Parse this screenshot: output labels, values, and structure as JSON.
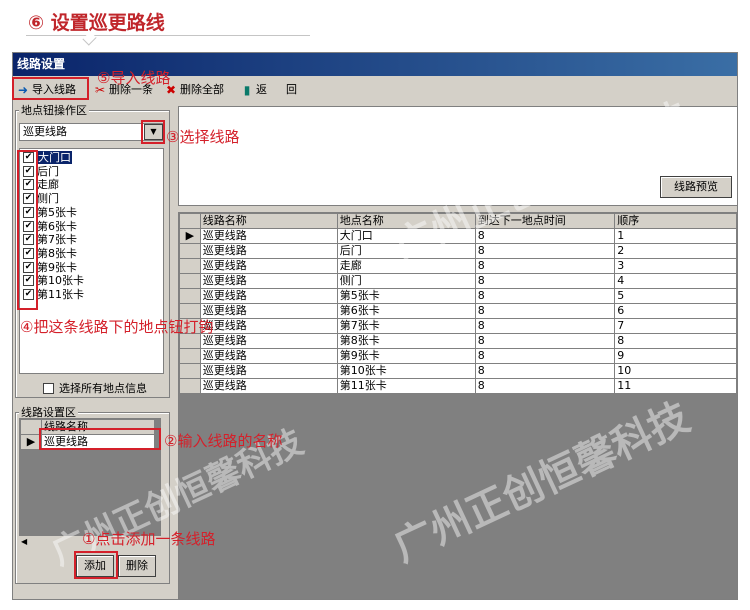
{
  "heading": "⑥ 设置巡更路线",
  "window": {
    "title": "线路设置"
  },
  "toolbar": {
    "import": "导入线路",
    "delete_one": "删除一条",
    "delete_all": "删除全部",
    "back": "返　回"
  },
  "locations_area": {
    "title": "地点钮操作区",
    "route_selected": "巡更线路",
    "items": [
      "大门口",
      "后门",
      "走廊",
      "侧门",
      "第5张卡",
      "第6张卡",
      "第7张卡",
      "第8张卡",
      "第9张卡",
      "第10张卡",
      "第11张卡"
    ],
    "select_all": "选择所有地点信息"
  },
  "preview_button": "线路预览",
  "grid": {
    "headers": [
      "线路名称",
      "地点名称",
      "到达下一地点时间",
      "顺序"
    ],
    "rows": [
      [
        "巡更线路",
        "大门口",
        "8",
        "1"
      ],
      [
        "巡更线路",
        "后门",
        "8",
        "2"
      ],
      [
        "巡更线路",
        "走廊",
        "8",
        "3"
      ],
      [
        "巡更线路",
        "侧门",
        "8",
        "4"
      ],
      [
        "巡更线路",
        "第5张卡",
        "8",
        "5"
      ],
      [
        "巡更线路",
        "第6张卡",
        "8",
        "6"
      ],
      [
        "巡更线路",
        "第7张卡",
        "8",
        "7"
      ],
      [
        "巡更线路",
        "第8张卡",
        "8",
        "8"
      ],
      [
        "巡更线路",
        "第9张卡",
        "8",
        "9"
      ],
      [
        "巡更线路",
        "第10张卡",
        "8",
        "10"
      ],
      [
        "巡更线路",
        "第11张卡",
        "8",
        "11"
      ]
    ]
  },
  "route_area": {
    "title": "线路设置区",
    "header": "线路名称",
    "value": "巡更线路",
    "add": "添加",
    "delete": "删除"
  },
  "annotations": {
    "a1": "①点击添加一条线路",
    "a2": "②输入线路的名称",
    "a3": "③选择线路",
    "a4": "④把这条线路下的地点钮打钩",
    "a5": "⑤导入线路"
  },
  "watermark": "广州正创恒馨科技",
  "colors": {
    "annotation": "#d4202a",
    "titlebar": "#0a246a",
    "heading": "#c0262b"
  }
}
